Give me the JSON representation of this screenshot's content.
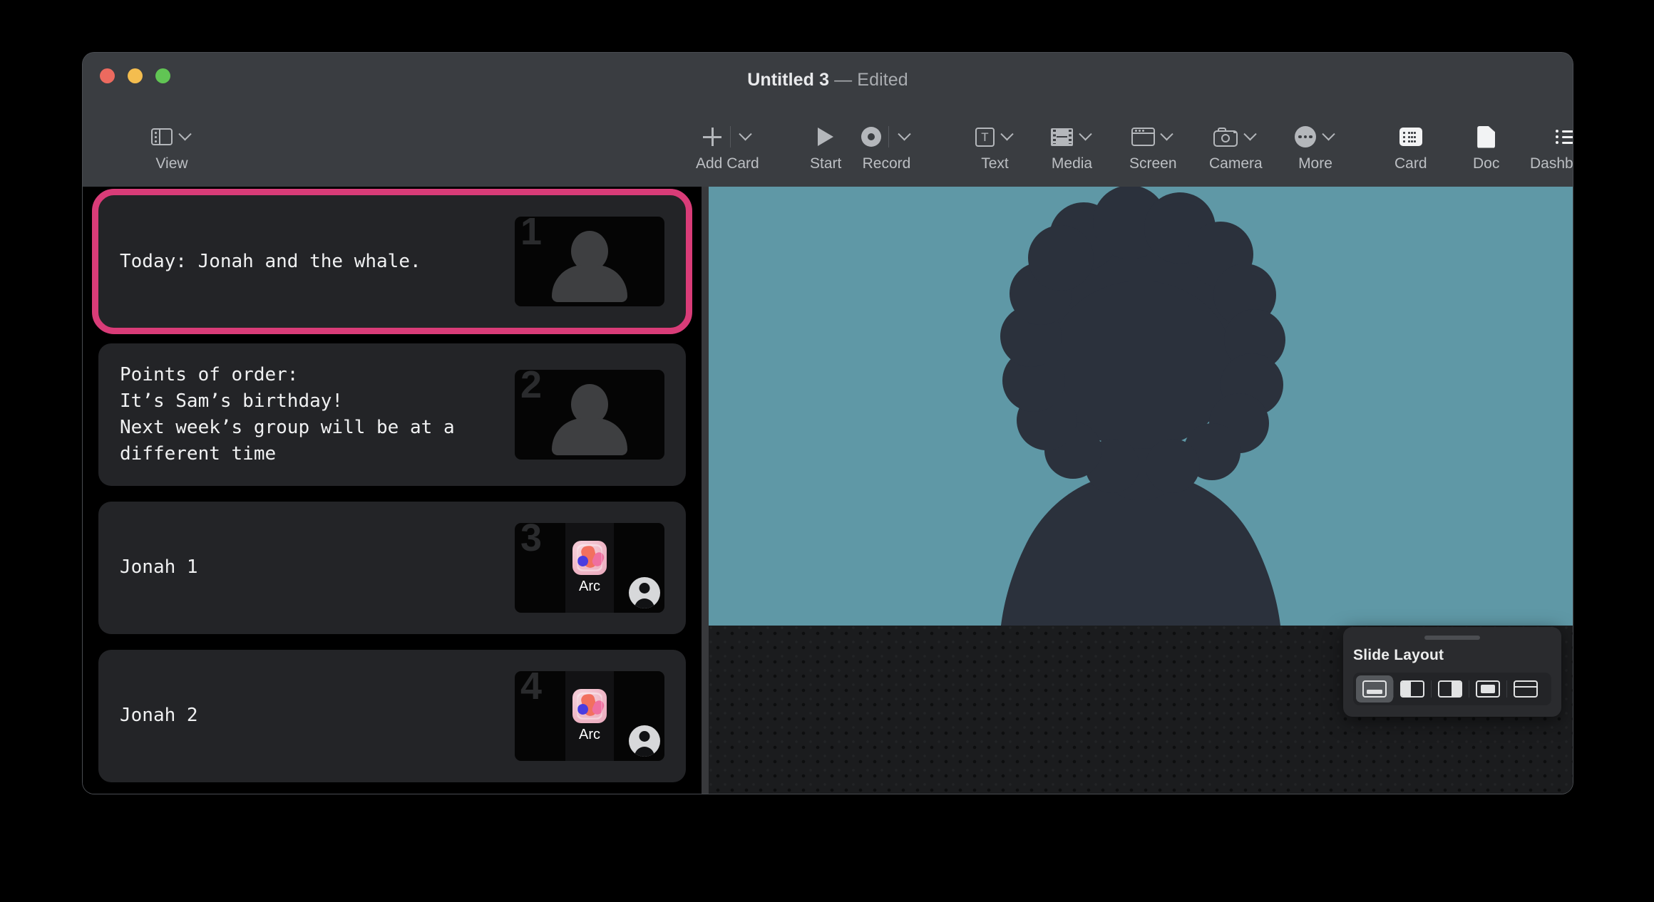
{
  "window": {
    "title_main": "Untitled 3",
    "title_dash": "—",
    "title_status": "Edited",
    "accent_selected": "#d93c78",
    "slide_bg": "#5f98a6"
  },
  "traffic_lights": {
    "close_label": "close",
    "minimize_label": "minimize",
    "maximize_label": "maximize"
  },
  "toolbar": {
    "view": {
      "label": "View",
      "icon": "sidebar-icon",
      "chevron": "chevron-down-icon"
    },
    "add_card": {
      "label": "Add Card",
      "icon": "plus-icon",
      "chevron": "chevron-down-icon"
    },
    "start": {
      "label": "Start",
      "icon": "play-icon"
    },
    "record": {
      "label": "Record",
      "icon": "record-icon",
      "chevron": "chevron-down-icon"
    },
    "text": {
      "label": "Text",
      "icon": "text-icon",
      "chevron": "chevron-down-icon"
    },
    "media": {
      "label": "Media",
      "icon": "filmstrip-icon",
      "chevron": "chevron-down-icon"
    },
    "screen": {
      "label": "Screen",
      "icon": "window-icon",
      "chevron": "chevron-down-icon"
    },
    "camera": {
      "label": "Camera",
      "icon": "camera-icon",
      "chevron": "chevron-down-icon"
    },
    "more": {
      "label": "More",
      "icon": "ellipsis-circle-icon",
      "chevron": "chevron-down-icon"
    },
    "card": {
      "label": "Card",
      "icon": "card-list-icon"
    },
    "doc": {
      "label": "Doc",
      "icon": "document-icon"
    },
    "dashboard": {
      "label": "Dashboard",
      "icon": "bulleted-list-icon"
    }
  },
  "sidebar": {
    "cards": [
      {
        "number": "1",
        "text": "Today: Jonah and the whale.",
        "selected": true,
        "thumb_type": "person",
        "app_label": ""
      },
      {
        "number": "2",
        "text": "Points of order:\nIt’s Sam’s birthday!\nNext week’s group will be at a different time",
        "selected": false,
        "thumb_type": "person",
        "app_label": ""
      },
      {
        "number": "3",
        "text": "Jonah 1",
        "selected": false,
        "thumb_type": "app",
        "app_label": "Arc"
      },
      {
        "number": "4",
        "text": "Jonah 2",
        "selected": false,
        "thumb_type": "app",
        "app_label": "Arc"
      }
    ]
  },
  "slide_layout": {
    "title": "Slide Layout",
    "options": [
      {
        "name": "caption-bottom",
        "selected": true
      },
      {
        "name": "split-left",
        "selected": false
      },
      {
        "name": "split-right",
        "selected": false
      },
      {
        "name": "centered-inset",
        "selected": false
      },
      {
        "name": "title-bar-top",
        "selected": false
      }
    ]
  }
}
